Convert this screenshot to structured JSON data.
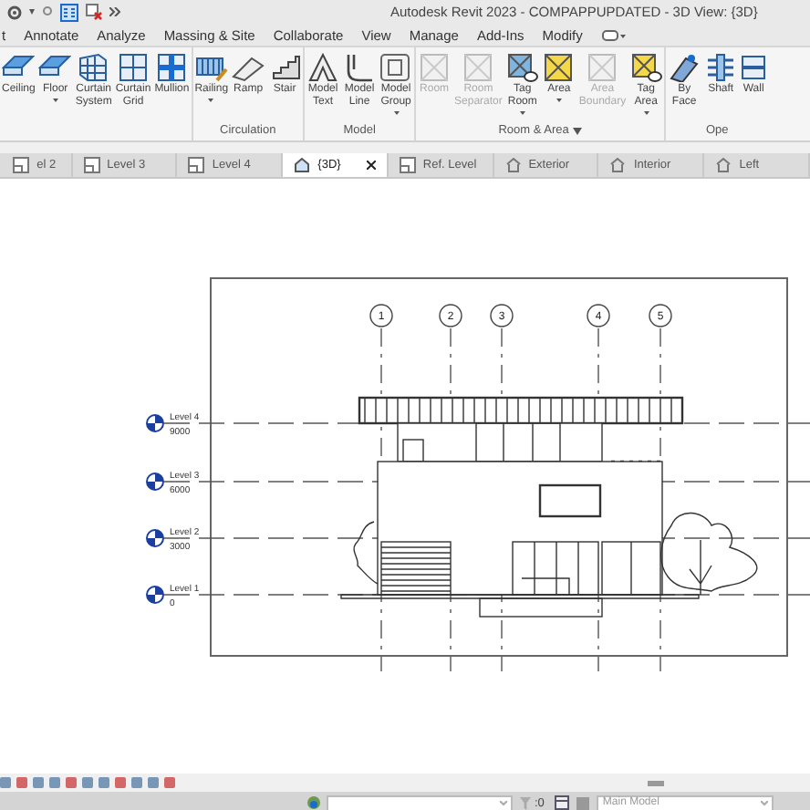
{
  "window": {
    "title": "Autodesk Revit 2023 - COMPAPPUPDATED - 3D View: {3D}"
  },
  "menu_tabs": [
    {
      "label": "t",
      "selected": false
    },
    {
      "label": "Annotate",
      "selected": false
    },
    {
      "label": "Analyze",
      "selected": false
    },
    {
      "label": "Massing & Site",
      "selected": false
    },
    {
      "label": "Collaborate",
      "selected": false
    },
    {
      "label": "View",
      "selected": false
    },
    {
      "label": "Manage",
      "selected": false
    },
    {
      "label": "Add-Ins",
      "selected": false
    },
    {
      "label": "Modify",
      "selected": false
    }
  ],
  "ribbon": [
    {
      "menu": false,
      "tools": [
        {
          "label": "Ceiling",
          "kind": "ceiling",
          "dropdown": false,
          "disabled": false
        },
        {
          "label": "Floor",
          "kind": "floor",
          "dropdown": true,
          "disabled": false
        },
        {
          "label": "Curtain System",
          "kind": "curtain-system",
          "dropdown": false,
          "disabled": false
        },
        {
          "label": "Curtain Grid",
          "kind": "curtain-grid",
          "dropdown": false,
          "disabled": false
        },
        {
          "label": "Mullion",
          "kind": "mullion",
          "dropdown": false,
          "disabled": false
        }
      ]
    },
    {
      "label": "Circulation",
      "menu": false,
      "tools": [
        {
          "label": "Railing",
          "kind": "railing",
          "dropdown": true,
          "disabled": false
        },
        {
          "label": "Ramp",
          "kind": "ramp",
          "dropdown": false,
          "disabled": false
        },
        {
          "label": "Stair",
          "kind": "stair",
          "dropdown": false,
          "disabled": false
        }
      ]
    },
    {
      "label": "Model",
      "menu": false,
      "tools": [
        {
          "label": "Model Text",
          "kind": "model-text",
          "dropdown": false,
          "disabled": false
        },
        {
          "label": "Model Line",
          "kind": "model-line",
          "dropdown": false,
          "disabled": false
        },
        {
          "label": "Model Group",
          "kind": "model-group",
          "dropdown": true,
          "disabled": false
        }
      ]
    },
    {
      "label": "Room & Area",
      "menu": true,
      "tools": [
        {
          "label": "Room",
          "kind": "room",
          "dropdown": false,
          "disabled": true
        },
        {
          "label": "Room Separator",
          "kind": "room",
          "dropdown": false,
          "disabled": true
        },
        {
          "label": "Tag Room",
          "kind": "tag-room",
          "dropdown": true,
          "disabled": false
        },
        {
          "label": "Area",
          "kind": "area",
          "dropdown": true,
          "disabled": false
        },
        {
          "label": "Area Boundary",
          "kind": "room",
          "dropdown": false,
          "disabled": true
        },
        {
          "label": "Tag Area",
          "kind": "tag-area",
          "dropdown": true,
          "disabled": false
        }
      ]
    },
    {
      "label": "Ope",
      "menu": false,
      "tools": [
        {
          "label": "By Face",
          "kind": "by-face",
          "dropdown": false,
          "disabled": false
        },
        {
          "label": "Shaft",
          "kind": "shaft",
          "dropdown": false,
          "disabled": false
        },
        {
          "label": "Wall",
          "kind": "wall",
          "dropdown": false,
          "disabled": false
        }
      ]
    }
  ],
  "view_tabs": [
    {
      "label": "el 2",
      "kind": "plan",
      "selected": false
    },
    {
      "label": "Level 3",
      "kind": "plan",
      "selected": false
    },
    {
      "label": "Level 4",
      "kind": "plan",
      "selected": false
    },
    {
      "label": "{3D}",
      "kind": "perspective",
      "selected": true
    },
    {
      "label": "Ref. Level",
      "kind": "plan",
      "selected": false
    },
    {
      "label": "Exterior",
      "kind": "elevation",
      "selected": false
    },
    {
      "label": "Interior",
      "kind": "elevation",
      "selected": false
    },
    {
      "label": "Left",
      "kind": "elevation",
      "selected": false
    }
  ],
  "view": {
    "grids": [
      {
        "label": "1"
      },
      {
        "label": "2"
      },
      {
        "label": "3"
      },
      {
        "label": "4"
      },
      {
        "label": "5"
      }
    ],
    "levels": [
      {
        "name": "Level 4",
        "elevation": "9000"
      },
      {
        "name": "Level 3",
        "elevation": "6000"
      },
      {
        "name": "Level 2",
        "elevation": "3000"
      },
      {
        "name": "Level 1",
        "elevation": "0"
      }
    ]
  },
  "status_bar": {
    "filter_count": ":0",
    "model": "Main Model"
  }
}
